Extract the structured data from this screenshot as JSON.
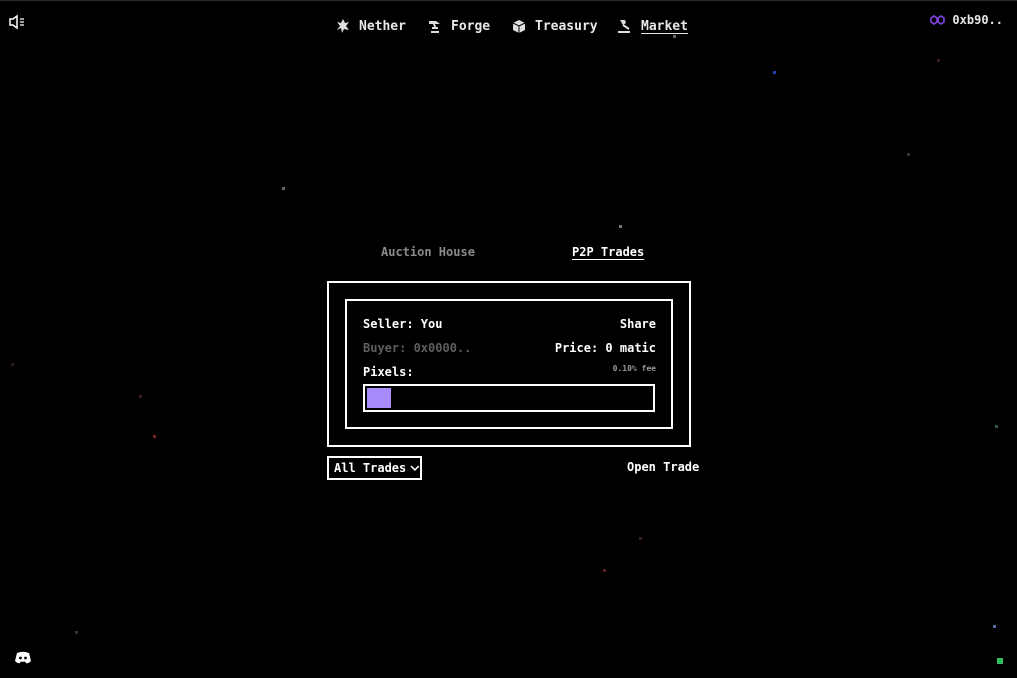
{
  "nav": {
    "items": [
      {
        "label": "Nether",
        "icon": "nether-icon"
      },
      {
        "label": "Forge",
        "icon": "forge-icon"
      },
      {
        "label": "Treasury",
        "icon": "treasury-icon"
      },
      {
        "label": "Market",
        "icon": "market-icon",
        "active": true
      }
    ]
  },
  "wallet": {
    "address": "0xb90..",
    "icon": "polygon-icon",
    "icon_color": "#8247e5"
  },
  "tabs": {
    "auction": "Auction House",
    "p2p": "P2P Trades",
    "active": "P2P Trades"
  },
  "trade": {
    "seller_label": "Seller: You",
    "share_label": "Share",
    "buyer_label": "Buyer: 0x0000..",
    "price_label": "Price: 0 matic",
    "fee_label": "0.10% fee",
    "pixels_label": "Pixels:",
    "pixel_fill_fraction": 0.085,
    "pixel_color": "#a78bfa"
  },
  "filter": {
    "selected": "All Trades"
  },
  "actions": {
    "open_trade": "Open Trade"
  },
  "colors": {
    "background": "#000000",
    "text": "#ffffff",
    "muted": "#5e5e5e",
    "accent": "#a78bfa"
  }
}
